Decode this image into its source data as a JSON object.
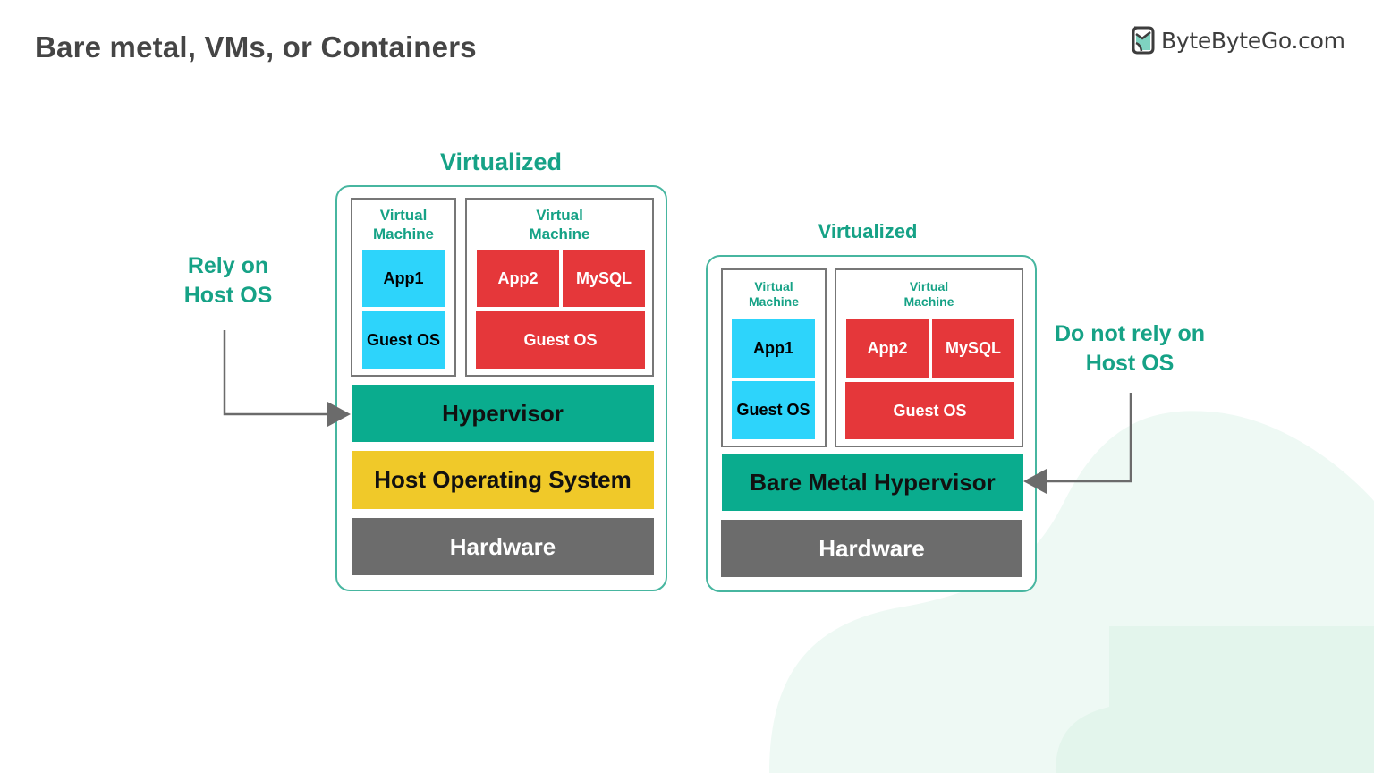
{
  "header": {
    "title": "Bare metal, VMs, or Containers",
    "brand": "ByteByteGo.com"
  },
  "colors": {
    "teal_text": "#16a286",
    "frame_border": "#47b6a0",
    "app_cyan": "#2dd4fb",
    "app_red": "#e5373a",
    "hypervisor_teal": "#0aac8e",
    "host_os_yellow": "#f0c929",
    "hardware_gray": "#6c6c6c",
    "arrow_gray": "#6b6b6b"
  },
  "left_diagram": {
    "title": "Virtualized",
    "annotation": [
      "Rely on",
      "Host OS"
    ],
    "vms": [
      {
        "label": [
          "Virtual",
          "Machine"
        ],
        "apps": [
          "App1"
        ],
        "guest_os": "Guest OS",
        "color": "cyan"
      },
      {
        "label": [
          "Virtual",
          "Machine"
        ],
        "apps": [
          "App2",
          "MySQL"
        ],
        "guest_os": "Guest OS",
        "color": "red"
      }
    ],
    "layers": [
      "Hypervisor",
      "Host Operating System",
      "Hardware"
    ]
  },
  "right_diagram": {
    "title": "Virtualized",
    "annotation": [
      "Do not rely on",
      "Host OS"
    ],
    "vms": [
      {
        "label": [
          "Virtual",
          "Machine"
        ],
        "apps": [
          "App1"
        ],
        "guest_os": "Guest OS",
        "color": "cyan"
      },
      {
        "label": [
          "Virtual",
          "Machine"
        ],
        "apps": [
          "App2",
          "MySQL"
        ],
        "guest_os": "Guest OS",
        "color": "red"
      }
    ],
    "layers": [
      "Bare Metal Hypervisor",
      "Hardware"
    ]
  }
}
